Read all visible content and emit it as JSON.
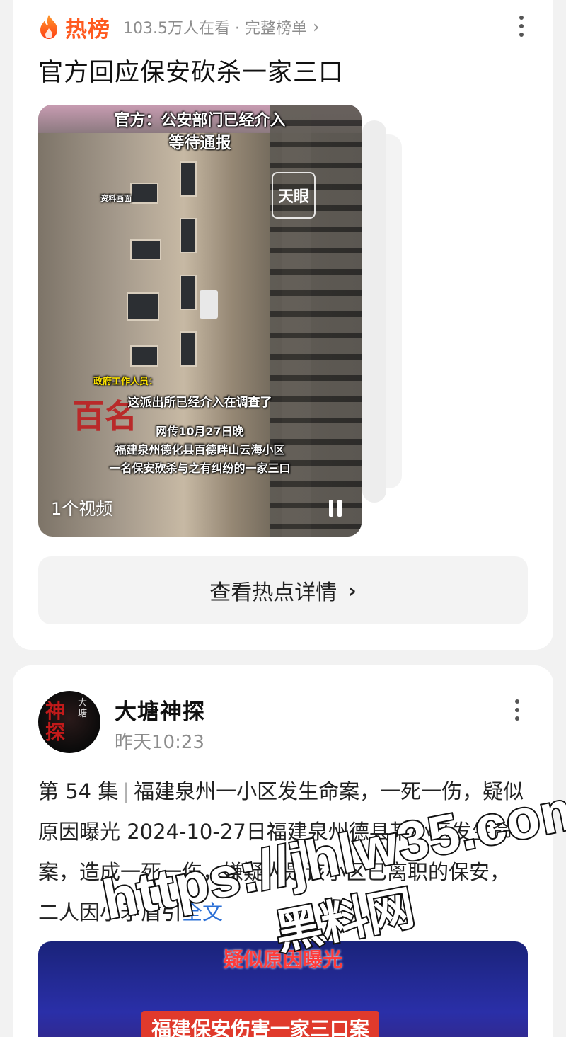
{
  "hot_card": {
    "brand": "热榜",
    "meta": "103.5万人在看 · 完整榜单",
    "headline": "官方回应保安砍杀一家三口",
    "video": {
      "caption_top_1": "官方：公安部门已经介入",
      "caption_top_2": "等待通报",
      "archive_label": "资料画面",
      "logo_text": "天眼",
      "gov_label": "政府工作人员：",
      "caption_quote": "这派出所已经介入在调查了",
      "caption_line_1": "网传10月27日晚",
      "caption_line_2": "福建泉州德化县百德畔山云海小区",
      "caption_line_3": "一名保安砍杀与之有纠纷的一家三口",
      "building_sign": "百名",
      "count_label": "1个视频"
    },
    "detail_button": "查看热点详情"
  },
  "post_card": {
    "avatar_text": "神探",
    "avatar_side": "大塘",
    "author": "大塘神探",
    "time": "昨天10:23",
    "episode": "第 54 集",
    "body": "福建泉州一小区发生命案，一死一伤，疑似原因曝光 2024-10-27日福建泉州德县某小区发生命案，造成一死一伤，嫌疑人是该小区已离职的保安，二人因小矛盾引",
    "full_text_link": "全文",
    "media": {
      "caption_1": "疑似原因曝光",
      "caption_2": "福建保安伤害一家三口案"
    }
  },
  "watermark": {
    "url": "https://jhlw35.com",
    "name": "黑料网"
  },
  "colors": {
    "accent_orange": "#ff5a1f",
    "link_blue": "#2a6fd6",
    "meta_gray": "#8c8c8c"
  }
}
